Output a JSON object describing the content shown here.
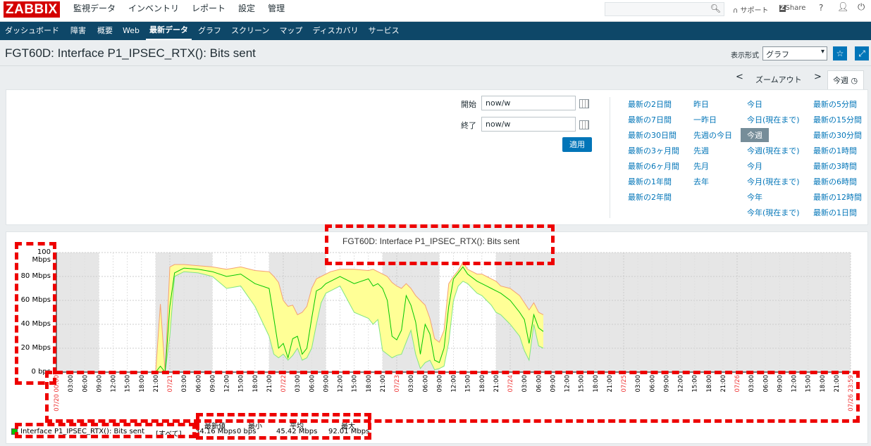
{
  "app": {
    "logo": "ZABBIX"
  },
  "top_menu": [
    {
      "label": "監視データ",
      "active": true
    },
    {
      "label": "インベントリ"
    },
    {
      "label": "レポート"
    },
    {
      "label": "設定"
    },
    {
      "label": "管理"
    }
  ],
  "top_right": {
    "support": "サポート",
    "share": "Share",
    "help": "?"
  },
  "sub_menu": [
    {
      "label": "ダッシュボード"
    },
    {
      "label": "障害"
    },
    {
      "label": "概要"
    },
    {
      "label": "Web"
    },
    {
      "label": "最新データ",
      "active": true
    },
    {
      "label": "グラフ"
    },
    {
      "label": "スクリーン"
    },
    {
      "label": "マップ"
    },
    {
      "label": "ディスカバリ"
    },
    {
      "label": "サービス"
    }
  ],
  "page": {
    "title": "FGT60D: Interface P1_IPSEC_RTX(): Bits sent",
    "view_as_label": "表示形式",
    "view_as_value": "グラフ"
  },
  "zoom": {
    "prev": "<",
    "zoom_out": "ズームアウト",
    "next": ">",
    "current_tab": "今週"
  },
  "filter": {
    "from_label": "開始",
    "from_value": "now/w",
    "to_label": "終了",
    "to_value": "now/w",
    "apply": "適用",
    "quick_ranges": [
      [
        "最新の2日間",
        "最新の7日間",
        "最新の30日間",
        "最新の3ヶ月間",
        "最新の6ヶ月間",
        "最新の1年間",
        "最新の2年間"
      ],
      [
        "昨日",
        "一昨日",
        "先週の今日",
        "先週",
        "先月",
        "去年"
      ],
      [
        "今日",
        "今日(現在まで)",
        "今週",
        "今週(現在まで)",
        "今月",
        "今月(現在まで)",
        "今年",
        "今年(現在まで)"
      ],
      [
        "最新の5分間",
        "最新の15分間",
        "最新の30分間",
        "最新の1時間",
        "最新の3時間",
        "最新の6時間",
        "最新の12時間",
        "最新の1日間"
      ]
    ],
    "selected": "今週"
  },
  "chart_data": {
    "type": "area",
    "title": "FGT60D: Interface P1_IPSEC_RTX(): Bits sent",
    "y_tick_labels": [
      "100 Mbps",
      "80 Mbps",
      "60 Mbps",
      "40 Mbps",
      "20 Mbps",
      "0 bps"
    ],
    "ylim": [
      0,
      100
    ],
    "yunit": "Mbps",
    "x_start_label": "07/20 00:00",
    "x_end_label": "07/26 23:59",
    "day_labels": [
      "07/21",
      "07/22",
      "07/23",
      "07/24",
      "07/25",
      "07/26"
    ],
    "hour_labels": [
      "03:00",
      "06:00",
      "09:00",
      "12:00",
      "15:00",
      "18:00",
      "21:00"
    ],
    "series": [
      {
        "name": "Interface P1_IPSEC_RTX(): Bits sent",
        "hours": [
          0,
          6,
          12,
          18,
          21,
          22,
          23,
          24,
          25,
          27,
          30,
          33,
          36,
          39,
          42,
          45,
          46,
          47,
          48,
          49,
          50,
          51,
          52,
          53,
          54,
          55,
          56,
          57,
          58,
          60,
          63,
          66,
          67,
          68,
          69,
          70,
          71,
          72,
          73,
          74,
          75,
          76,
          77,
          78,
          79,
          80,
          81,
          82,
          83,
          84,
          85,
          86,
          87,
          88,
          89,
          90,
          91,
          92,
          93,
          94,
          96,
          98,
          99,
          100,
          101,
          102,
          103
        ],
        "avg": [
          0,
          0,
          0,
          0,
          0,
          5,
          0,
          55,
          83,
          87,
          86,
          84,
          80,
          82,
          74,
          70,
          45,
          20,
          24,
          12,
          28,
          30,
          15,
          20,
          45,
          68,
          70,
          74,
          76,
          80,
          74,
          78,
          72,
          74,
          70,
          60,
          30,
          27,
          35,
          64,
          56,
          42,
          15,
          40,
          32,
          10,
          8,
          20,
          55,
          78,
          83,
          88,
          82,
          79,
          76,
          74,
          72,
          70,
          68,
          66,
          60,
          50,
          44,
          24,
          48,
          37,
          34
        ],
        "min": [
          0,
          0,
          0,
          0,
          0,
          0,
          0,
          30,
          80,
          84,
          83,
          80,
          70,
          72,
          55,
          30,
          15,
          12,
          15,
          10,
          14,
          20,
          10,
          12,
          20,
          40,
          58,
          66,
          68,
          72,
          50,
          45,
          40,
          44,
          18,
          15,
          12,
          14,
          15,
          25,
          35,
          15,
          3,
          8,
          10,
          2,
          3,
          5,
          25,
          60,
          72,
          76,
          74,
          70,
          66,
          64,
          60,
          56,
          50,
          48,
          40,
          30,
          18,
          10,
          40,
          22,
          20
        ],
        "max": [
          0,
          0,
          0,
          0,
          0,
          57,
          0,
          88,
          90,
          90,
          89,
          88,
          86,
          88,
          85,
          84,
          80,
          75,
          60,
          55,
          56,
          48,
          50,
          55,
          70,
          78,
          80,
          82,
          84,
          86,
          86,
          85,
          86,
          84,
          82,
          80,
          75,
          72,
          70,
          74,
          70,
          64,
          60,
          56,
          45,
          28,
          25,
          35,
          74,
          80,
          85,
          92,
          86,
          84,
          82,
          82,
          80,
          78,
          76,
          72,
          70,
          64,
          58,
          52,
          58,
          50,
          48
        ]
      }
    ],
    "stats_header": [
      "最新値",
      "最小",
      "平均",
      "最大"
    ],
    "stats_row": {
      "name": "Interface P1_IPSEC_RTX(): Bits sent",
      "func": "[すべて]",
      "last": "34.16 Mbps",
      "min": "0 bps",
      "avg": "45.42 Mbps",
      "max": "92.01 Mbps"
    },
    "legend_color": "#00C800"
  }
}
